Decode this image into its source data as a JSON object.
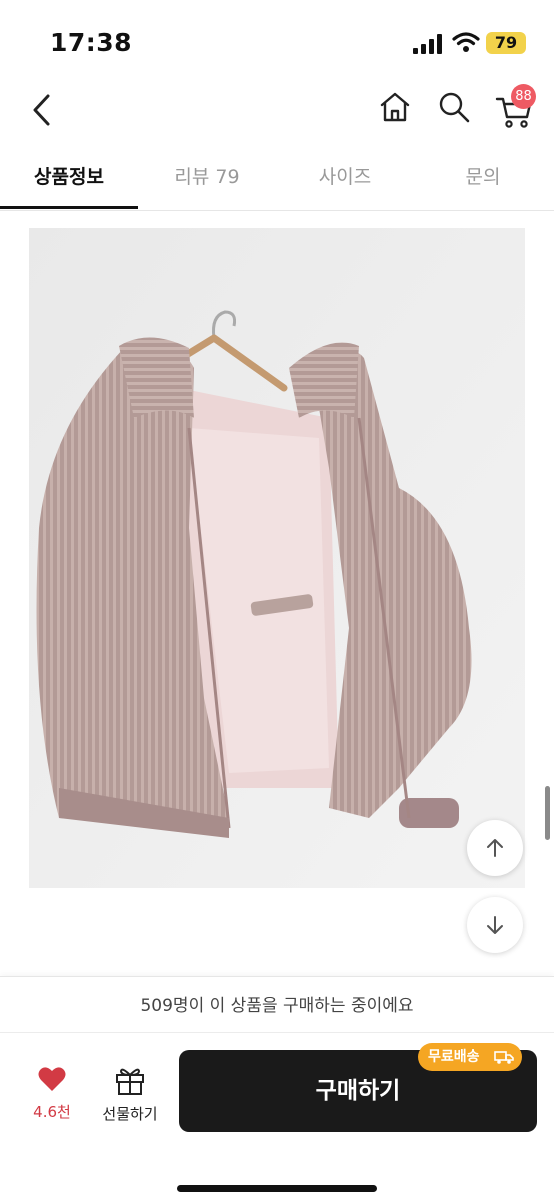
{
  "status_bar": {
    "time": "17:38",
    "battery": "79"
  },
  "header": {
    "cart_count": "88"
  },
  "tabs": [
    {
      "label": "상품정보",
      "active": true
    },
    {
      "label": "리뷰 79",
      "active": false
    },
    {
      "label": "사이즈",
      "active": false
    },
    {
      "label": "문의",
      "active": false
    }
  ],
  "notice": "509명이 이 상품을 구매하는 중이에요",
  "bottom_bar": {
    "like_count": "4.6천",
    "gift_label": "선물하기",
    "buy_label": "구매하기",
    "shipping_badge": "무료배송"
  },
  "colors": {
    "accent_red": "#d23a44",
    "badge_red": "#ee5a63",
    "shipping_orange": "#f5a623",
    "buy_button": "#1a1a1a"
  },
  "icons": [
    "back-arrow-icon",
    "home-icon",
    "search-icon",
    "cart-icon",
    "heart-icon",
    "gift-icon",
    "truck-icon",
    "arrow-up-icon",
    "arrow-down-icon"
  ]
}
